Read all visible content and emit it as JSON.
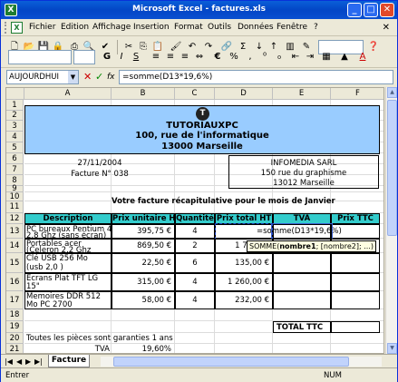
{
  "window": {
    "title": "Microsoft Excel - factures.xls"
  },
  "menu": [
    "Fichier",
    "Edition",
    "Affichage",
    "Insertion",
    "Format",
    "Outils",
    "Données",
    "Fenêtre",
    "?"
  ],
  "toolbar": {
    "zoom": "",
    "sigma": "Σ",
    "euro": "€",
    "bold": "G",
    "italic": "I",
    "underline": "S",
    "font_color_letter": "A"
  },
  "formula_bar": {
    "name_box": "AUJOURDHUI",
    "cancel": "✕",
    "enter": "✓",
    "fx": "fx",
    "formula": "=somme(D13*19,6%)"
  },
  "columns": [
    "A",
    "B",
    "C",
    "D",
    "E",
    "F"
  ],
  "rows": [
    "1",
    "2",
    "3",
    "4",
    "5",
    "6",
    "7",
    "8",
    "9",
    "10",
    "11",
    "12",
    "13",
    "14",
    "15",
    "16",
    "17",
    "18",
    "19",
    "20",
    "21"
  ],
  "header": {
    "logo": "T",
    "company": "TUTORIAUXPC",
    "street": "100, rue de l'informatique",
    "city": "13000 Marseille"
  },
  "invoice": {
    "date": "27/11/2004",
    "number": "Facture N° 038"
  },
  "client": {
    "name": "INFOMEDIA SARL",
    "street": "150 rue du graphisme",
    "city": "13012 Marseille"
  },
  "table": {
    "caption": "Votre facture récapitulative pour le mois de Janvier",
    "headers": [
      "Description",
      "Prix unitaire HT",
      "Quantité",
      "Prix total HT",
      "TVA",
      "Prix TTC"
    ],
    "rows": [
      {
        "desc1": "PC bureaux Pentium 4",
        "desc2": "2,8 Ghz (sans écran)",
        "unit": "395,75 €",
        "qty": "4",
        "total": "",
        "tva": "=somme(D13*19,6%)"
      },
      {
        "desc1": "Portables acer",
        "desc2": "(Celeron 2,2 Ghz",
        "unit": "869,50 €",
        "qty": "2",
        "total": "1 739,00",
        "tva": ""
      },
      {
        "desc1": "Clé USB 256 Mo",
        "desc2": "(usb 2,0 )",
        "unit": "22,50 €",
        "qty": "6",
        "total": "135,00 €",
        "tva": ""
      },
      {
        "desc1": "Ecrans Plat TFT     LG",
        "desc2": "15\"",
        "unit": "315,00 €",
        "qty": "4",
        "total": "1 260,00 €",
        "tva": ""
      },
      {
        "desc1": "Memoires DDR 512",
        "desc2": "Mo PC 2700",
        "unit": "58,00 €",
        "qty": "4",
        "total": "232,00 €",
        "tva": ""
      }
    ],
    "total_label": "TOTAL TTC"
  },
  "tooltip": {
    "fn": "SOMME(",
    "arg1": "nombre1",
    "rest": "; [nombre2]; ...)"
  },
  "footer": {
    "guarantee": "Toutes les pièces sont garanties 1 ans",
    "tva_label": "TVA",
    "tva_value": "19,60%"
  },
  "sheet_tab": "Facture",
  "status": {
    "mode": "Entrer",
    "num": "NUM"
  },
  "colors": {
    "title_bg": "#99ccff",
    "header_bg": "#33cccc",
    "accent": "#0a5fd8"
  }
}
